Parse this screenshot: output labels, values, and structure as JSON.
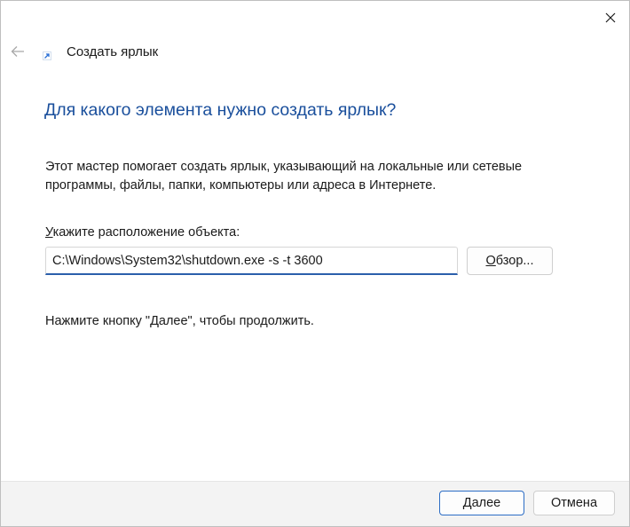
{
  "window": {
    "title": "Создать ярлык",
    "close_icon": "close-icon",
    "back_icon": "arrow-left-icon",
    "shortcut_icon": "shortcut-arrow-icon"
  },
  "main": {
    "heading": "Для какого элемента нужно создать ярлык?",
    "description": "Этот мастер помогает создать ярлык, указывающий на локальные или сетевые программы, файлы, папки, компьютеры или адреса в Интернете.",
    "location_label_accel": "У",
    "location_label_rest": "кажите расположение объекта:",
    "location_value": "C:\\Windows\\System32\\shutdown.exe -s -t 3600",
    "browse_accel": "О",
    "browse_rest": "бзор...",
    "hint": "Нажмите кнопку \"Далее\", чтобы продолжить."
  },
  "footer": {
    "next_accel": "Д",
    "next_rest": "алее",
    "cancel_label": "Отмена"
  },
  "colors": {
    "heading": "#1a4f9c",
    "accent": "#2b5fab",
    "footer_bg": "#f3f3f3"
  }
}
